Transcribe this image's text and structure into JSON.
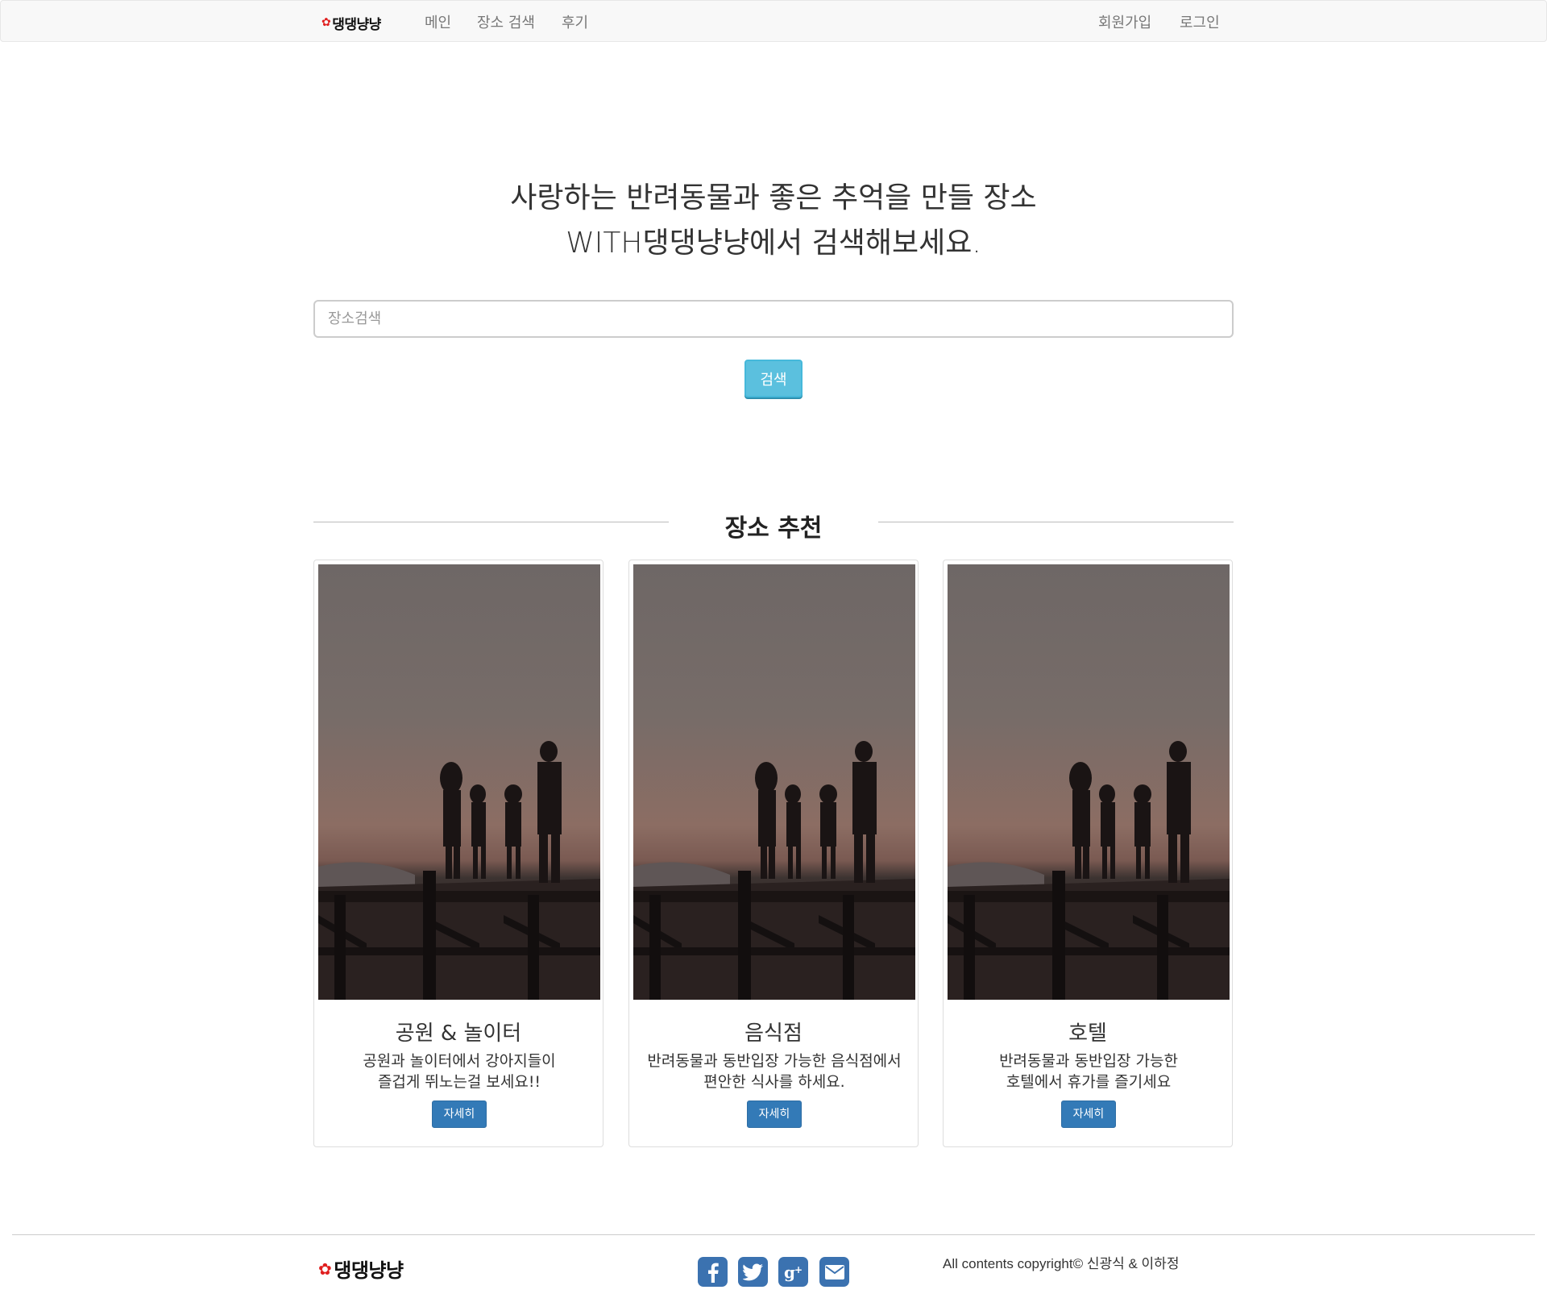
{
  "navbar": {
    "brand": "댕댕냥냥",
    "links": [
      "메인",
      "장소 검색",
      "후기"
    ],
    "right_links": [
      "회원가입",
      "로그인"
    ]
  },
  "hero": {
    "line1": "사랑하는 반려동물과 좋은 추억을 만들 장소",
    "line2": "WITH댕댕냥냥에서 검색해보세요."
  },
  "search": {
    "placeholder": "장소검색",
    "value": "",
    "button_label": "검색"
  },
  "recommend": {
    "title": "장소 추천",
    "cards": [
      {
        "title": "공원 & 놀이터",
        "desc1": "공원과 놀이터에서 강아지들이",
        "desc2": "즐겁게 뛰노는걸 보세요!!",
        "button": "자세히"
      },
      {
        "title": "음식점",
        "desc1": "반려동물과 동반입장 가능한 음식점에서",
        "desc2": "편안한 식사를 하세요.",
        "button": "자세히"
      },
      {
        "title": "호텔",
        "desc1": "반려동물과 동반입장 가능한",
        "desc2": "호텔에서 휴가를 즐기세요",
        "button": "자세히"
      }
    ]
  },
  "footer": {
    "brand": "댕댕냥냥",
    "social_icons": [
      "facebook-icon",
      "twitter-icon",
      "google-plus-icon",
      "email-icon"
    ],
    "copyright": "All contents copyright© 신광식 & 이하정"
  },
  "colors": {
    "primary_button": "#337ab7",
    "info_button": "#5bc0de",
    "social_icon": "#3b72b0",
    "paw": "#e01f1f"
  }
}
